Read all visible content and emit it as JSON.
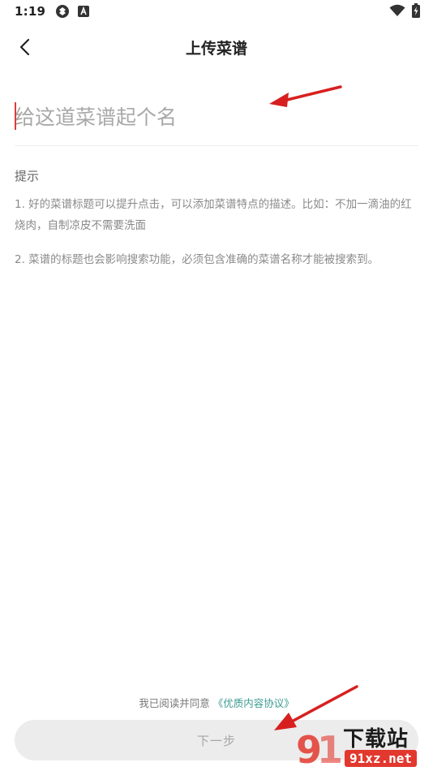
{
  "status_bar": {
    "time": "1:19",
    "icons": [
      "app-sync-icon",
      "a-badge-icon",
      "wifi-icon",
      "battery-charging-icon"
    ]
  },
  "header": {
    "title": "上传菜谱",
    "back_icon": "chevron-left-icon"
  },
  "recipe_name_input": {
    "placeholder": "给这道菜谱起个名",
    "value": ""
  },
  "tips": {
    "heading": "提示",
    "items": [
      "1. 好的菜谱标题可以提升点击，可以添加菜谱特点的描述。比如：不加一滴油的红烧肉，自制凉皮不需要洗面",
      "2. 菜谱的标题也会影响搜索功能，必须包含准确的菜谱名称才能被搜索到。"
    ]
  },
  "agreement": {
    "prefix": "我已阅读并同意",
    "link": "《优质内容协议》"
  },
  "next_button": {
    "label": "下一步"
  },
  "watermark": {
    "site_name": "下载站",
    "domain": "91xz.net"
  },
  "colors": {
    "caret": "#e23a3a",
    "link": "#3a9a8f",
    "button_bg": "#ececec",
    "annotation_arrow": "#d81f1f"
  }
}
